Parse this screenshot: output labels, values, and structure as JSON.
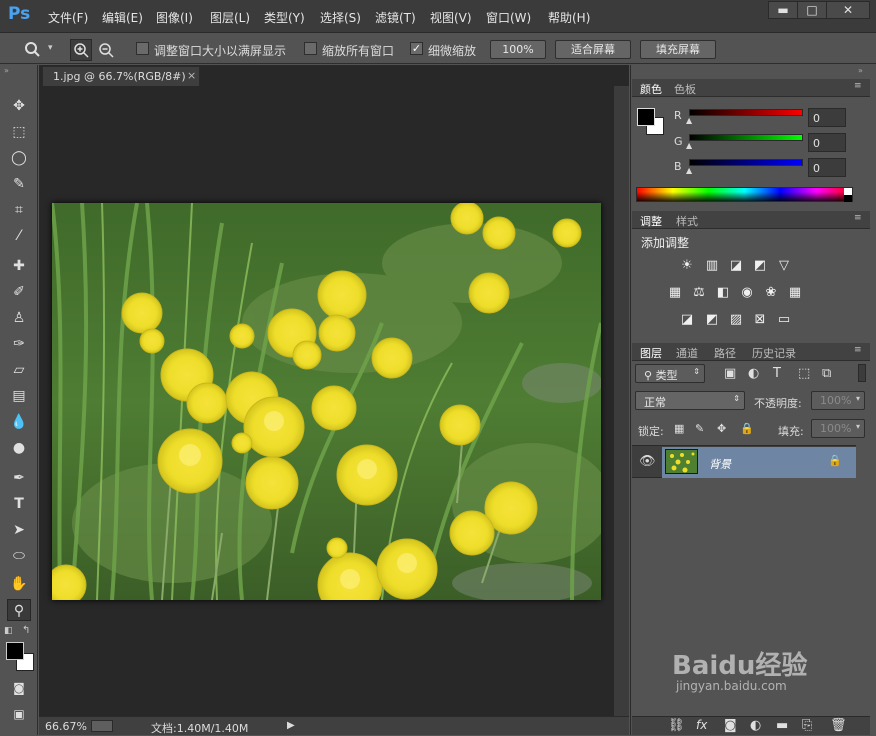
{
  "app": {
    "logo": "Ps"
  },
  "menu": [
    {
      "label": "文件(F)",
      "name": "menu-file"
    },
    {
      "label": "编辑(E)",
      "name": "menu-edit"
    },
    {
      "label": "图像(I)",
      "name": "menu-image"
    },
    {
      "label": "图层(L)",
      "name": "menu-layer"
    },
    {
      "label": "类型(Y)",
      "name": "menu-type"
    },
    {
      "label": "选择(S)",
      "name": "menu-select"
    },
    {
      "label": "滤镜(T)",
      "name": "menu-filter"
    },
    {
      "label": "视图(V)",
      "name": "menu-view"
    },
    {
      "label": "窗口(W)",
      "name": "menu-window"
    },
    {
      "label": "帮助(H)",
      "name": "menu-help"
    }
  ],
  "window_buttons": {
    "minimize": "▬",
    "maximize": "□",
    "close": "✕"
  },
  "options": {
    "resize_windows": "调整窗口大小以满屏显示",
    "zoom_all": "缩放所有窗口",
    "scrubby_zoom": "细微缩放",
    "scrubby_checked": "✓",
    "btn_100": "100%",
    "btn_fit": "适合屏幕",
    "btn_fill": "填充屏幕"
  },
  "document": {
    "tab_label": "1.jpg @ 66.7%(RGB/8#)",
    "tab_close": "×",
    "zoom_level": "66.67%",
    "doc_size": "文档:1.40M/1.40M"
  },
  "color_panel": {
    "tabs": [
      "颜色",
      "色板"
    ],
    "channels": [
      {
        "label": "R",
        "value": "0",
        "color": "#ff0000"
      },
      {
        "label": "G",
        "value": "0",
        "color": "#00ff00"
      },
      {
        "label": "B",
        "value": "0",
        "color": "#0000ff"
      }
    ],
    "foreground": "#000000",
    "background": "#ffffff"
  },
  "adjustments_panel": {
    "tabs": [
      "调整",
      "样式"
    ],
    "title": "添加调整"
  },
  "layers_panel": {
    "tabs": [
      "图层",
      "通道",
      "路径",
      "历史记录"
    ],
    "filter_kind": "类型",
    "blend_mode": "正常",
    "opacity_label": "不透明度:",
    "opacity_value": "100%",
    "lock_label": "锁定:",
    "fill_label": "填充:",
    "fill_value": "100%",
    "layers": [
      {
        "name": "背景",
        "visible": true,
        "locked": true
      }
    ]
  },
  "watermark": {
    "brand": "Baidu经验",
    "url": "jingyan.baidu.com"
  }
}
